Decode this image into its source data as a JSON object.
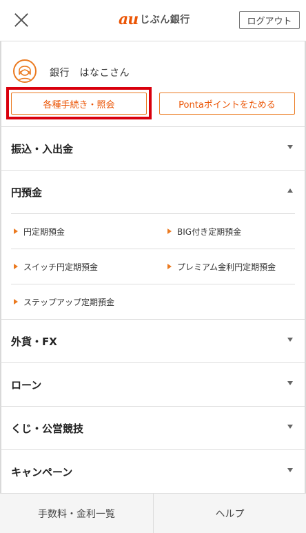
{
  "header": {
    "logo_au": "au",
    "logo_text": "じぶん銀行",
    "logout_label": "ログアウト"
  },
  "user": {
    "name": "銀行　はなこさん"
  },
  "actions": {
    "procedures_label": "各種手続き・照会",
    "ponta_label": "Pontaポイントをためる"
  },
  "menu": {
    "transfer": "振込・入出金",
    "yen_deposit": "円預金",
    "foreign": "外貨・FX",
    "loan": "ローン",
    "lottery": "くじ・公営競技",
    "campaign": "キャンペーン"
  },
  "yen_submenu": {
    "fixed": "円定期預金",
    "big": "BIG付き定期預金",
    "switch": "スイッチ円定期預金",
    "premium": "プレミアム金利円定期預金",
    "stepup": "ステップアップ定期預金"
  },
  "footer": {
    "fees": "手数料・金利一覧",
    "help": "ヘルプ"
  },
  "colors": {
    "accent": "#eb5505",
    "highlight": "#d9000d"
  }
}
